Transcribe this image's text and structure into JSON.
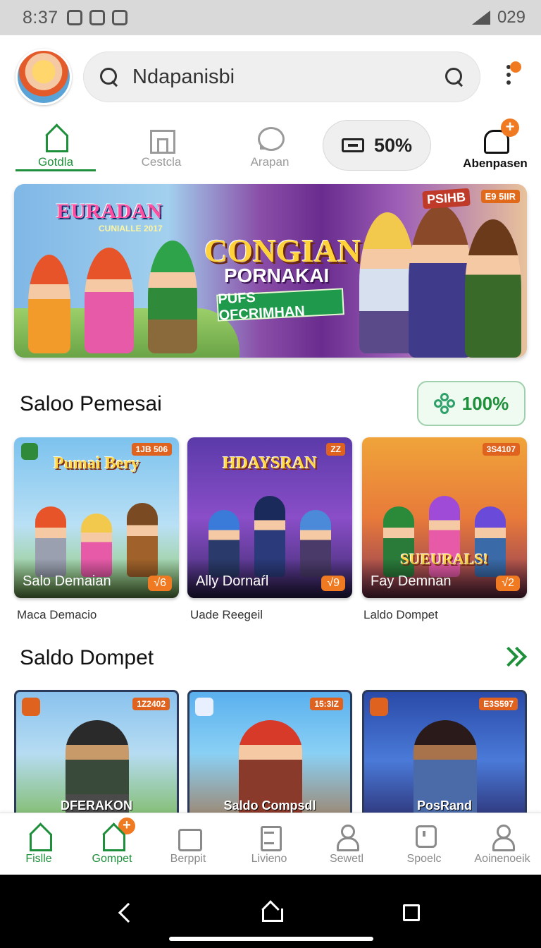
{
  "status_bar": {
    "time": "8:37",
    "battery": "029"
  },
  "header": {
    "search_text": "Ndapanisbi"
  },
  "tabs": [
    {
      "label": "Gotdla"
    },
    {
      "label": "Cestcla"
    },
    {
      "label": "Arapan"
    }
  ],
  "promo_pill": {
    "label": "50%"
  },
  "bell_tab": {
    "label": "Abenpasen",
    "badge": "+"
  },
  "hero": {
    "title": "EURADAN",
    "title_sub": "CUNIALLE 2017",
    "headline": "CONGIAN",
    "headline_2": "PORNAKAI",
    "ribbon": "PUFS OFCRIMHAN",
    "badge_left": "PSIHB",
    "badge_right": "E9 5IIR"
  },
  "section1": {
    "title": "Saloo Pemesai",
    "pill_label": "100%",
    "cards": [
      {
        "title": "Pumai Bery",
        "tag": "1JB 506",
        "caption": "Salo Demaian",
        "badge": "√6",
        "sub": "Maca Demacio"
      },
      {
        "title": "HDAYSRAN",
        "tag": "ZZ",
        "caption": "Ally Dornaŕl",
        "badge": "√9",
        "sub": "Uade Reegeil"
      },
      {
        "title": "SUEURALS!",
        "tag": "3S4107",
        "caption": "Fay Demnan",
        "badge": "√2",
        "sub": "Laldo Dompet"
      }
    ]
  },
  "section2": {
    "title": "Saldo Dompet",
    "cards": [
      {
        "tag": "1Z2402",
        "label": "DFERAKON"
      },
      {
        "tag": "15:3IZ",
        "label": "Saldo Compsdl"
      },
      {
        "tag": "E3S597",
        "label": "PosRand"
      }
    ]
  },
  "bottom_nav": [
    {
      "label": "Fislle",
      "icon": "home-icon"
    },
    {
      "label": "Gompet",
      "icon": "wallet-icon",
      "badge": "+"
    },
    {
      "label": "Berppit",
      "icon": "bag-icon"
    },
    {
      "label": "Livieno",
      "icon": "list-icon"
    },
    {
      "label": "Sewetl",
      "icon": "person-icon"
    },
    {
      "label": "Spoelc",
      "icon": "help-icon"
    },
    {
      "label": "Aoinenoeik",
      "icon": "account-icon"
    }
  ],
  "colors": {
    "accent": "#1e8f3a",
    "badge": "#f07a22"
  }
}
